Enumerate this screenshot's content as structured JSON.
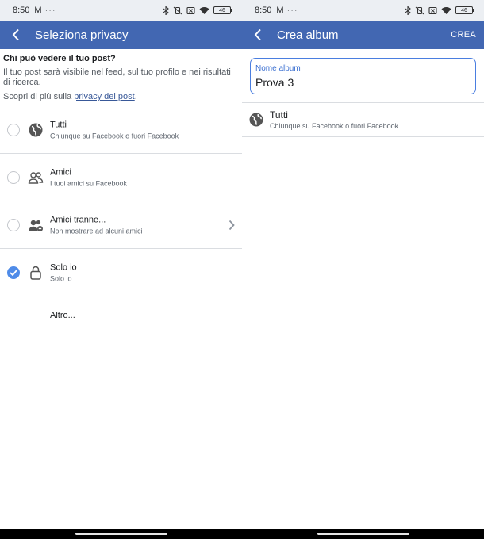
{
  "left": {
    "status": {
      "time": "8:50",
      "battery": "46"
    },
    "appbar": {
      "title": "Seleziona privacy"
    },
    "info": {
      "heading": "Chi può vedere il tuo post?",
      "description": "Il tuo post sarà visibile nel feed, sul tuo profilo e nei risultati di ricerca.",
      "more_prefix": "Scopri di più sulla ",
      "more_link": "privacy dei post",
      "more_suffix": "."
    },
    "options": [
      {
        "label": "Tutti",
        "sub": "Chiunque su Facebook o fuori Facebook",
        "icon": "globe-icon",
        "selected": false
      },
      {
        "label": "Amici",
        "sub": "I tuoi amici su Facebook",
        "icon": "friends-icon",
        "selected": false
      },
      {
        "label": "Amici tranne...",
        "sub": "Non mostrare ad alcuni amici",
        "icon": "friends-except-icon",
        "selected": false
      },
      {
        "label": "Solo io",
        "sub": "Solo io",
        "icon": "lock-icon",
        "selected": true
      },
      {
        "label": "Altro..."
      }
    ]
  },
  "right": {
    "status": {
      "time": "8:50",
      "battery": "46"
    },
    "appbar": {
      "title": "Crea album",
      "action": "CREA"
    },
    "field": {
      "label": "Nome album",
      "value": "Prova 3"
    },
    "audience": {
      "label": "Tutti",
      "sub": "Chiunque su Facebook o fuori Facebook",
      "icon": "globe-icon"
    }
  },
  "colors": {
    "appbar": "#4267b2",
    "accent": "#4f8be8",
    "link": "#385898"
  }
}
